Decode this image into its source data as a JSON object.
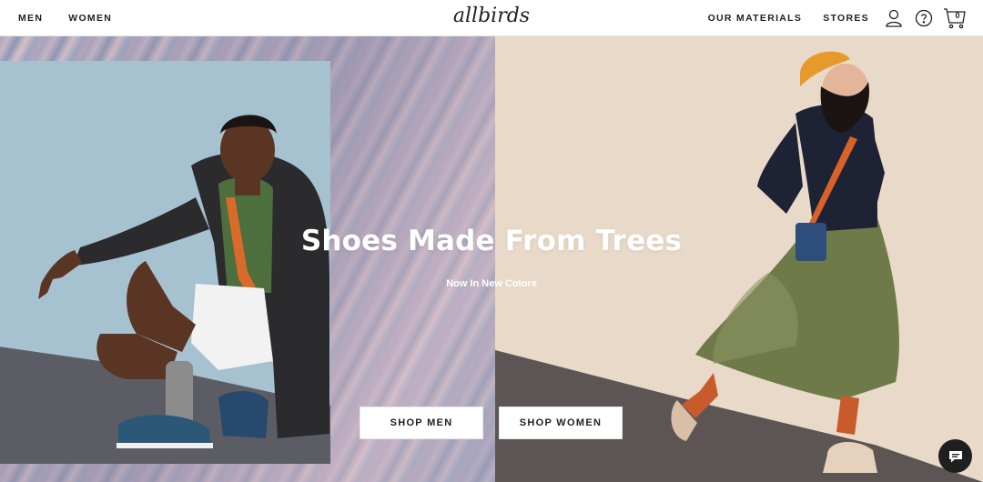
{
  "nav": {
    "left_links": [
      "MEN",
      "WOMEN"
    ],
    "right_links": [
      "OUR MATERIALS",
      "STORES"
    ],
    "logo_text": "allbirds",
    "icons": [
      "account-icon",
      "help-icon",
      "cart-icon"
    ],
    "cart_count": "0"
  },
  "hero": {
    "title": "Shoes Made From Trees",
    "subtitle": "Now In New Colors",
    "buttons": {
      "men": "SHOP MEN",
      "women": "SHOP WOMEN"
    }
  },
  "chat": {
    "icon": "chat-icon"
  },
  "colors": {
    "text": "#212121",
    "left_panel": "#a6c2d0",
    "right_panel": "#e9d9c8",
    "chat_button": "#1f1f1f"
  }
}
